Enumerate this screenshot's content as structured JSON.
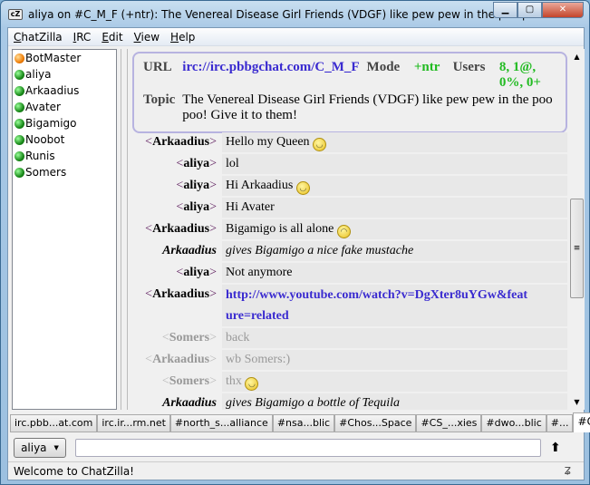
{
  "window": {
    "title": "aliya on #C_M_F (+ntr): The Venereal Disease Girl Friends (VDGF) like pew pew in the poo poo...",
    "logo": "cZ"
  },
  "menu": [
    {
      "label": "ChatZilla",
      "key": "C",
      "rest": "hatZilla"
    },
    {
      "label": "IRC",
      "key": "I",
      "rest": "RC"
    },
    {
      "label": "Edit",
      "key": "E",
      "rest": "dit"
    },
    {
      "label": "View",
      "key": "V",
      "rest": "iew"
    },
    {
      "label": "Help",
      "key": "H",
      "rest": "elp"
    }
  ],
  "users": [
    {
      "name": "BotMaster",
      "op": true
    },
    {
      "name": "aliya"
    },
    {
      "name": "Arkaadius"
    },
    {
      "name": "Avater"
    },
    {
      "name": "Bigamigo"
    },
    {
      "name": "Noobot"
    },
    {
      "name": "Runis"
    },
    {
      "name": "Somers"
    }
  ],
  "header": {
    "url_label": "URL",
    "url": "irc://irc.pbbgchat.com/C_M_F",
    "mode_label": "Mode",
    "mode": "+ntr",
    "users_label": "Users",
    "users": "8, 1@, 0%, 0+",
    "topic_label": "Topic",
    "topic": "The Venereal Disease Girl Friends (VDGF) like pew pew in the poo poo! Give it to them!"
  },
  "messages": [
    {
      "nick": "Arkaadius",
      "text": "Hello my Queen",
      "emoticon": "grin"
    },
    {
      "nick": "aliya",
      "text": "lol"
    },
    {
      "nick": "aliya",
      "text": "Hi Arkaadius",
      "emoticon": "smile"
    },
    {
      "nick": "aliya",
      "text": "Hi Avater"
    },
    {
      "nick": "Arkaadius",
      "text": "Bigamigo is all alone",
      "emoticon": "sad"
    },
    {
      "nick": "Arkaadius",
      "text": "gives Bigamigo a nice fake mustache",
      "action": true
    },
    {
      "nick": "aliya",
      "text": "Not anymore"
    },
    {
      "nick": "Arkaadius",
      "text": "http://www.youtube.com/watch?v=DgXter8uYGw&feature=related",
      "link": true
    },
    {
      "nick": "Somers",
      "text": "back",
      "faded": true
    },
    {
      "nick": "Arkaadius",
      "text": "wb Somers:)",
      "faded": true
    },
    {
      "nick": "Somers",
      "text": "thx",
      "emoticon": "grin",
      "faded": true
    },
    {
      "nick": "Arkaadius",
      "text": "gives Bigamigo a bottle of Tequila",
      "action": true
    }
  ],
  "tabs": [
    "irc.pbb...at.com",
    "irc.ir...rm.net",
    "#north_s...alliance",
    "#nsa...blic",
    "#Chos...Space",
    "#CS_...xies",
    "#dwo...blic",
    "#...",
    "#C...F"
  ],
  "active_tab": 8,
  "input": {
    "nick": "aliya",
    "value": ""
  },
  "status": "Welcome to ChatZilla!",
  "colors": {
    "link": "#3a2bd0",
    "mode": "#22bb22",
    "op_dot": "#f0800a",
    "voice_dot": "#1a8a1a"
  }
}
